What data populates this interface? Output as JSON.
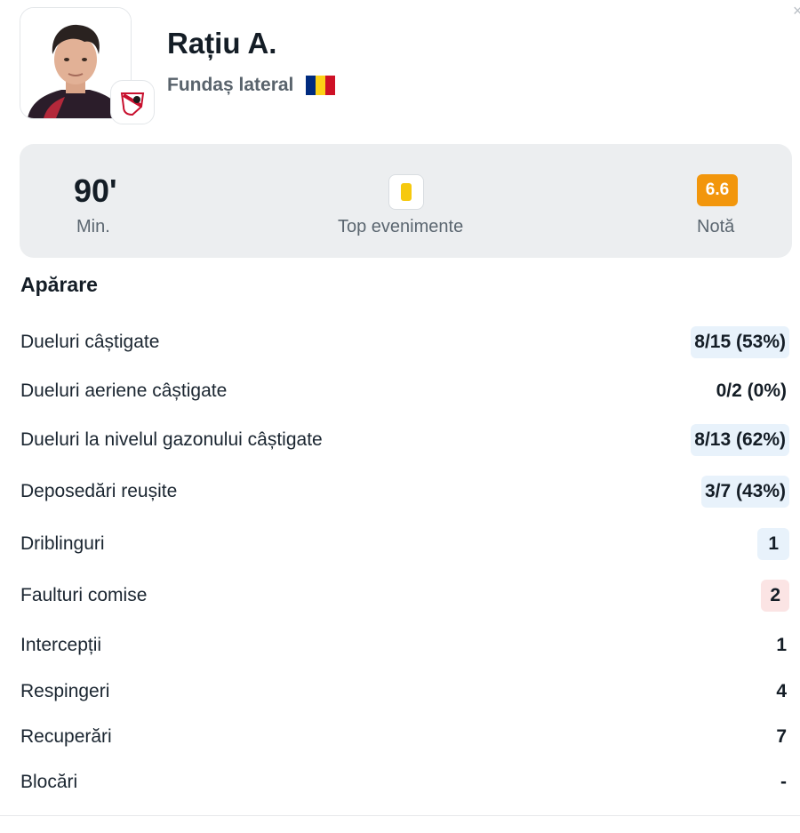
{
  "close_glyph": "×",
  "player": {
    "name": "Rațiu A.",
    "position": "Fundaș lateral",
    "flag_colors": [
      "#002B7F",
      "#FCD116",
      "#CE1126"
    ]
  },
  "summary": {
    "minutes_value": "90'",
    "minutes_label": "Min.",
    "events_label": "Top evenimente",
    "rating_value": "6.6",
    "rating_label": "Notă"
  },
  "section": {
    "title": "Apărare"
  },
  "stats": [
    {
      "label": "Dueluri câștigate",
      "value": "8/15 (53%)",
      "highlight": "blue"
    },
    {
      "label": "Dueluri aeriene câștigate",
      "value": "0/2 (0%)",
      "highlight": "none"
    },
    {
      "label": "Dueluri la nivelul gazonului câștigate",
      "value": "8/13 (62%)",
      "highlight": "blue"
    },
    {
      "label": "Deposedări reușite",
      "value": "3/7 (43%)",
      "highlight": "blue"
    },
    {
      "label": "Driblinguri",
      "value": "1",
      "highlight": "blue"
    },
    {
      "label": "Faulturi comise",
      "value": "2",
      "highlight": "red"
    },
    {
      "label": "Intercepții",
      "value": "1",
      "highlight": "none"
    },
    {
      "label": "Respingeri",
      "value": "4",
      "highlight": "none"
    },
    {
      "label": "Recuperări",
      "value": "7",
      "highlight": "none"
    },
    {
      "label": "Blocări",
      "value": "-",
      "highlight": "none"
    }
  ]
}
